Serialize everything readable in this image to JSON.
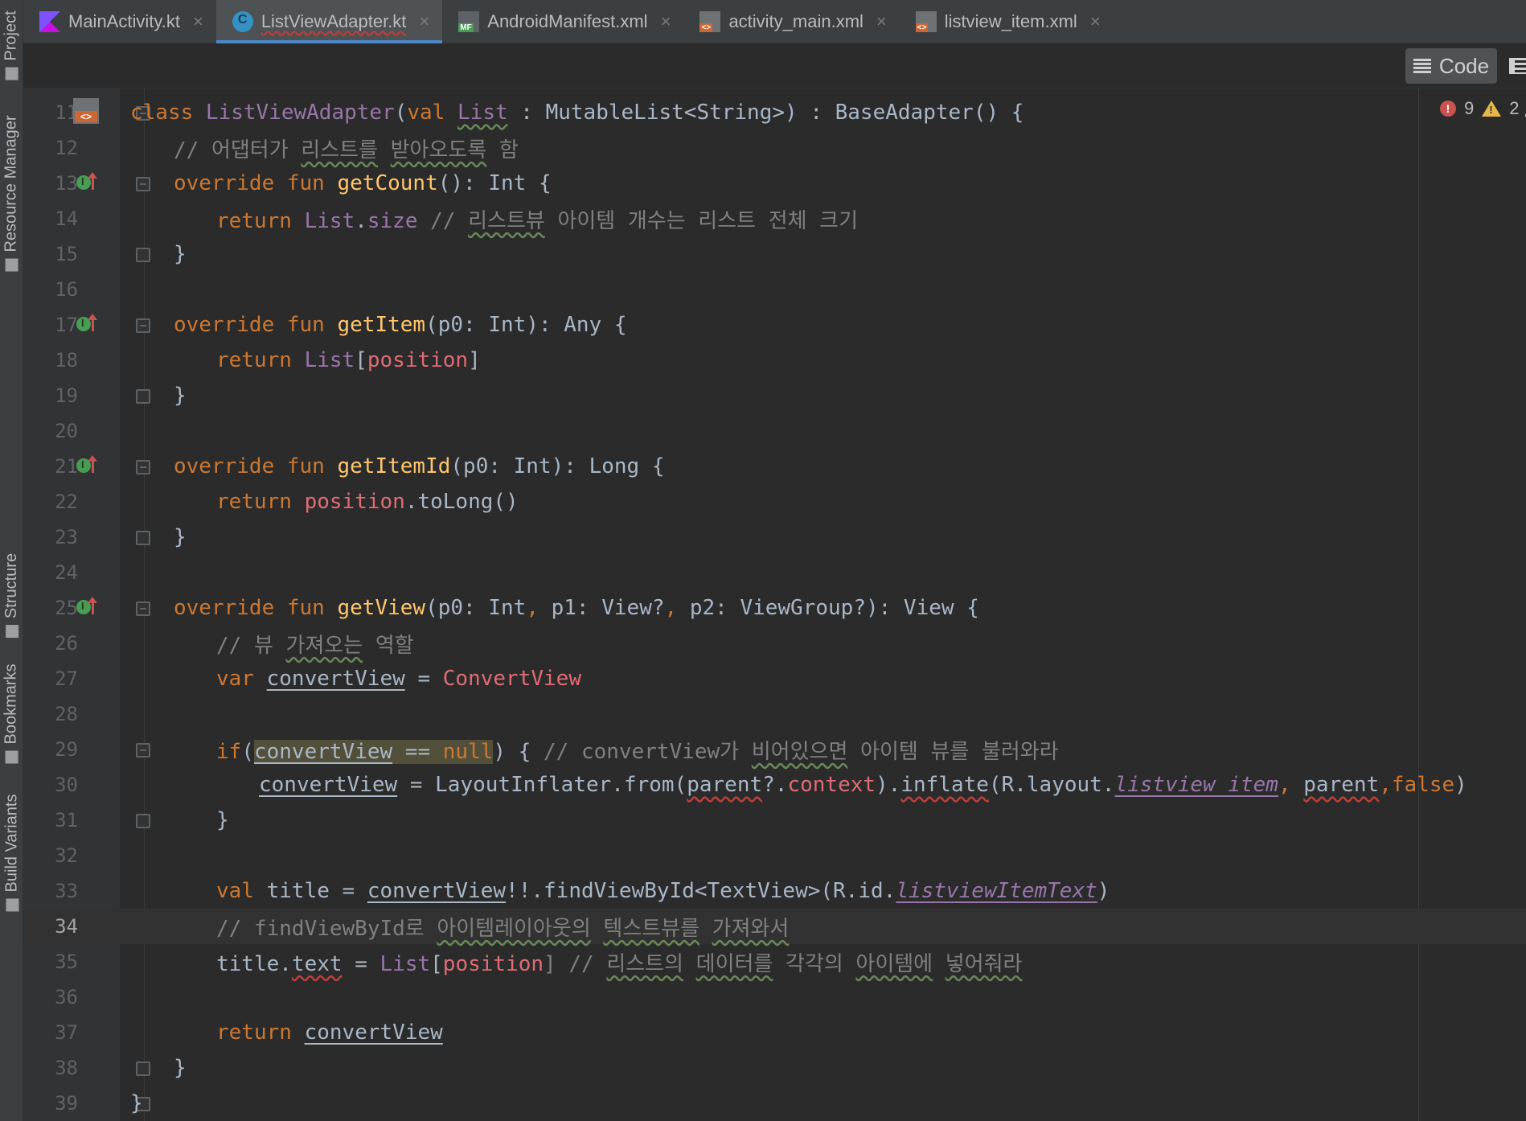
{
  "left_strip": {
    "tabs": [
      {
        "label": "Project"
      },
      {
        "label": "Resource Manager"
      },
      {
        "label": "Structure"
      },
      {
        "label": "Bookmarks"
      },
      {
        "label": "Build Variants"
      }
    ]
  },
  "tabs": [
    {
      "label": "MainActivity.kt",
      "icon": "kotlin-file-icon"
    },
    {
      "label": "ListViewAdapter.kt",
      "icon": "kotlin-class-icon",
      "active": true
    },
    {
      "label": "AndroidManifest.xml",
      "icon": "manifest-icon"
    },
    {
      "label": "activity_main.xml",
      "icon": "layout-xml-icon"
    },
    {
      "label": "listview_item.xml",
      "icon": "layout-xml-icon"
    }
  ],
  "toolbar": {
    "code_label": "Code",
    "split_label": "S"
  },
  "inspections": {
    "errors": "9",
    "warnings": "2"
  },
  "editor": {
    "first_visible_partial": "10",
    "current_line": "34",
    "line_numbers": [
      "11",
      "12",
      "13",
      "14",
      "15",
      "16",
      "17",
      "18",
      "19",
      "20",
      "21",
      "22",
      "23",
      "24",
      "25",
      "26",
      "27",
      "28",
      "29",
      "30",
      "31",
      "32",
      "33",
      "34",
      "35",
      "36",
      "37",
      "38",
      "39"
    ],
    "lines": {
      "l11": {
        "a": "class ",
        "b": "ListViewAdapter",
        "c": "(",
        "d": "val ",
        "e": "List",
        "f": " : MutableList<String>) : BaseAdapter() {"
      },
      "l12": {
        "a": "// 어댑터가 ",
        "b": "리스트를",
        "c": " ",
        "d": "받아오도록",
        "e": " 함"
      },
      "l13": {
        "a": "override fun ",
        "b": "getCount",
        "c": "(): Int {"
      },
      "l14": {
        "a": "return ",
        "b": "List",
        "c": ".",
        "d": "size",
        "e": " // ",
        "f": "리스트뷰",
        "g": " 아이템 개수는 리스트 전체 크기"
      },
      "l15": {
        "a": "}"
      },
      "l17": {
        "a": "override fun ",
        "b": "getItem",
        "c": "(p0: Int): Any {"
      },
      "l18": {
        "a": "return ",
        "b": "List",
        "c": "[",
        "d": "position",
        "e": "]"
      },
      "l19": {
        "a": "}"
      },
      "l21": {
        "a": "override fun ",
        "b": "getItemId",
        "c": "(p0: Int): Long {"
      },
      "l22": {
        "a": "return ",
        "b": "position",
        "c": ".toLong()"
      },
      "l23": {
        "a": "}"
      },
      "l25": {
        "a": "override fun ",
        "b": "getView",
        "c": "(p0: Int",
        ",": ", ",
        "d": "p1: View?",
        ",2": ", ",
        "e": "p2: ViewGroup?): View {"
      },
      "l26": {
        "a": "// 뷰 ",
        "b": "가져오는",
        "c": " 역할"
      },
      "l27": {
        "a": "var ",
        "b": "convertView",
        "c": " = ",
        "d": "ConvertView"
      },
      "l29": {
        "a": "if",
        "b": "(",
        "c": "convertView",
        "d": " == ",
        "e": "null",
        ")": ")",
        "f": " { ",
        "g": "// convertView가 ",
        "h": "비어있으면",
        "i": " 아이템 뷰를 불러와라"
      },
      "l30": {
        "a": "convertView",
        "b": " = LayoutInflater.from(",
        "c": "parent",
        "d": "?.",
        "e": "context",
        "f": ").",
        "g": "inflate",
        "h": "(R.layout.",
        "i": "listview_item",
        ",": ", ",
        "j": "parent",
        "k": ",",
        "l": "false",
        ")": ")"
      },
      "l31": {
        "a": "}"
      },
      "l33": {
        "a": "val ",
        "b": "title = ",
        "c": "convertView",
        "d": "!!.findViewById<TextView>(R.id.",
        "e": "listviewItemText",
        ")": ")"
      },
      "l34": {
        "a": "// findViewById로 ",
        "b": "아이템레이아웃의",
        "c": " ",
        "d": "텍스트뷰를",
        "e": " ",
        "f": "가져와서"
      },
      "l35": {
        "a": "title.",
        "b": "text",
        "c": " = ",
        "d": "List",
        "e": "[",
        "f": "position",
        "g": "] // ",
        "h": "리스트의",
        "i": " ",
        "j": "데이터를",
        "k": " 각각의 ",
        "l": "아이템에",
        "m": " ",
        "n": "넣어줘라"
      },
      "l37": {
        "a": "return ",
        "b": "convertView"
      },
      "l38": {
        "a": "}"
      },
      "l39": {
        "a": "}"
      }
    }
  },
  "colors": {
    "background": "#2b2b2b",
    "keyword": "#cc7832",
    "function": "#ffc66d",
    "comment": "#808080",
    "property": "#9876aa",
    "error": "#e06c75",
    "tab_active_underline": "#4a88c7"
  }
}
